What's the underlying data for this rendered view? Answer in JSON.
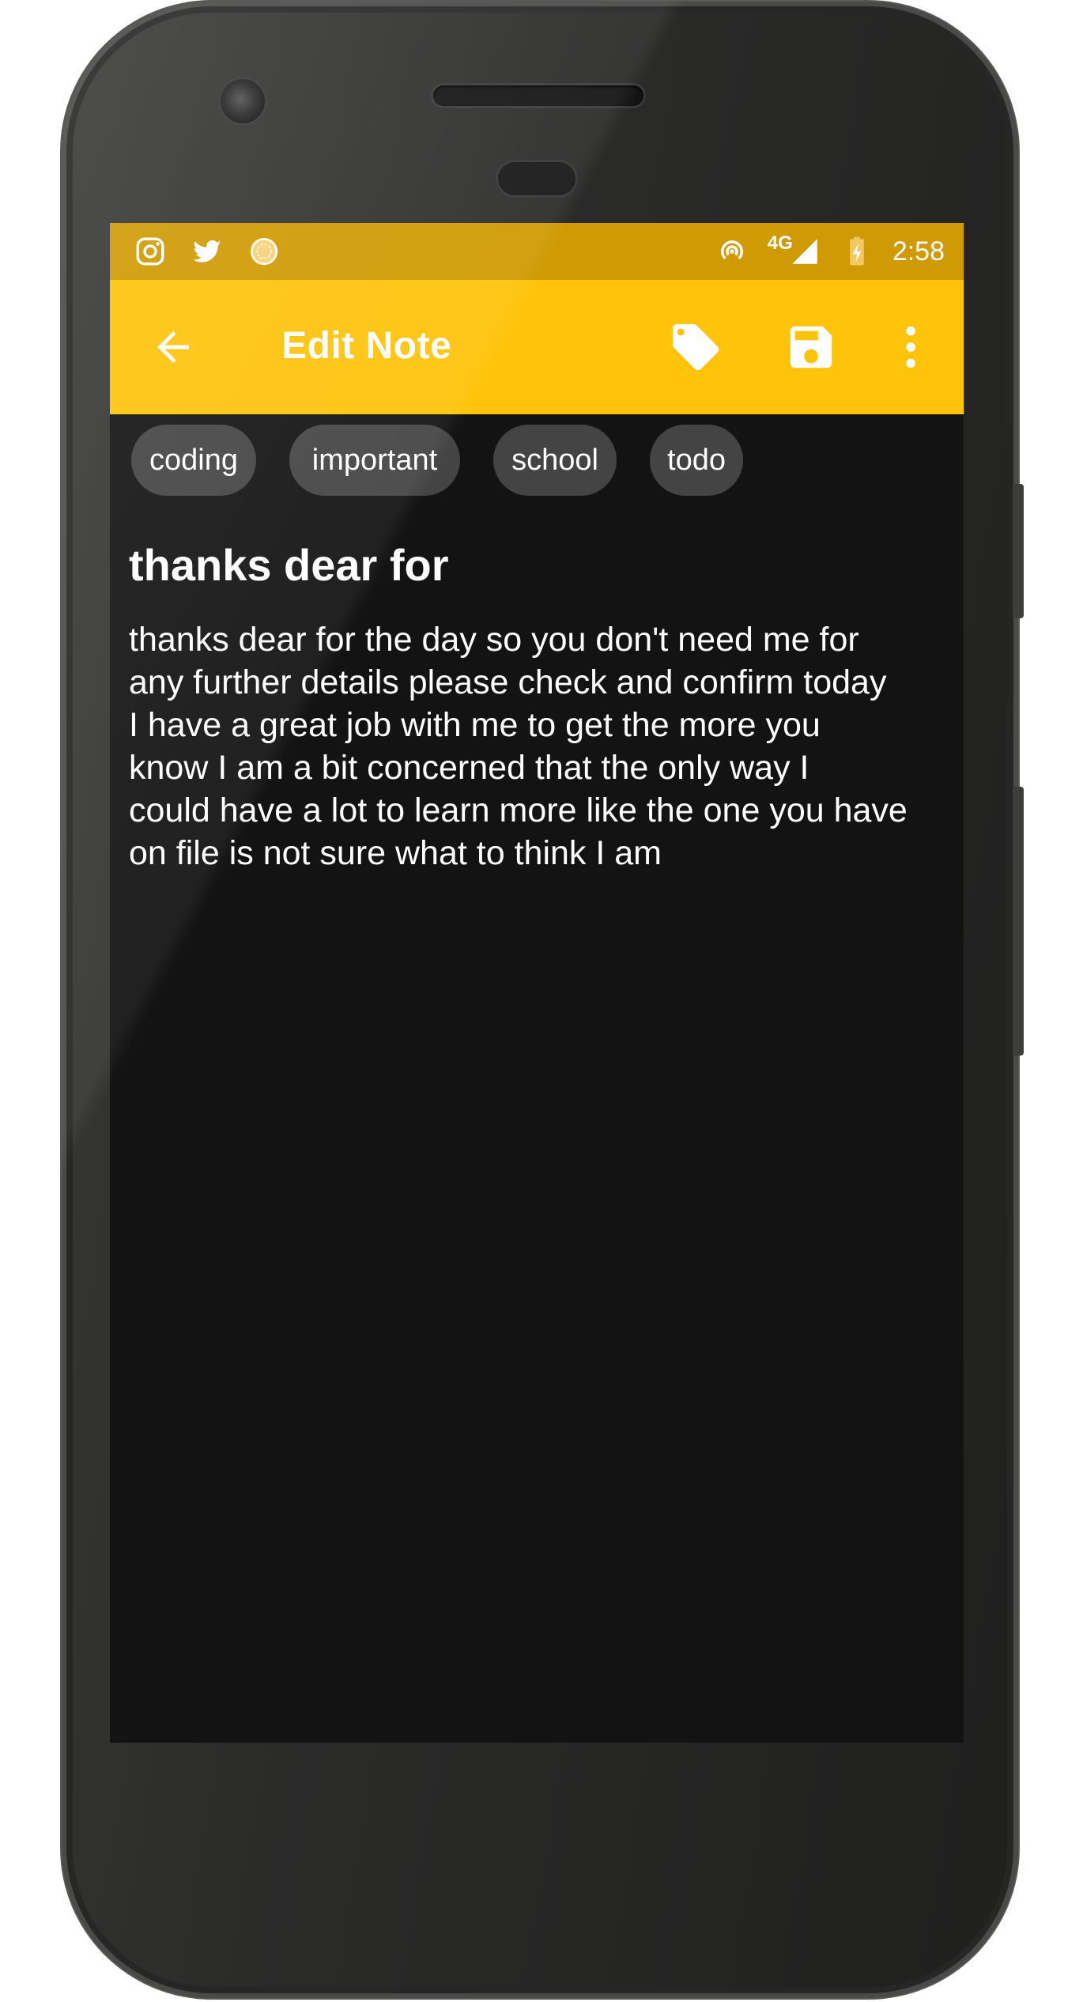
{
  "status_bar": {
    "left_icons": [
      "instagram-icon",
      "twitter-icon",
      "loading-circle-icon"
    ],
    "network": "4G",
    "time": "2:58"
  },
  "app_bar": {
    "title": "Edit Note",
    "actions": [
      "tag-icon",
      "save-icon",
      "more-vert-icon"
    ]
  },
  "tags": [
    "coding",
    "important",
    "school",
    "todo"
  ],
  "note": {
    "title": "thanks dear for",
    "body": "thanks dear for the day so you don't need me for\nany further details please check and confirm today\nI have a great job with me to get the more you\nknow I am a bit concerned that the only way I\ncould have a lot to learn more like the one you have\non file is not sure what to think I am"
  },
  "colors": {
    "status_bar": "#cf9a03",
    "app_bar": "#ffc30a",
    "background": "#131313",
    "chip": "#444444",
    "text": "#ffffff"
  }
}
